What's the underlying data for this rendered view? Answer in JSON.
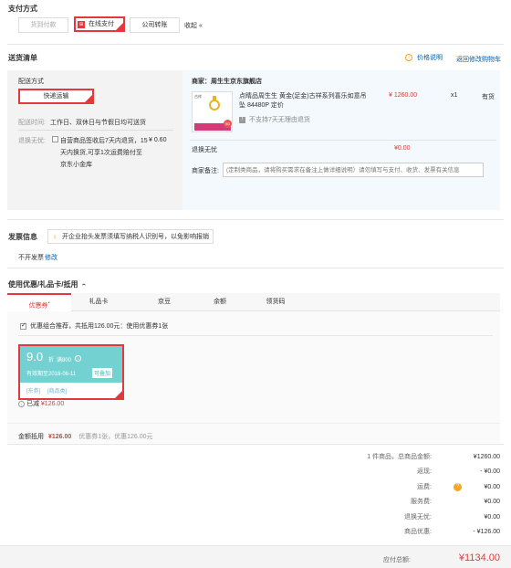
{
  "payment": {
    "title": "支付方式",
    "methods": [
      "货到付款",
      "在线支付",
      "公司转账"
    ],
    "collapse": "收起 «"
  },
  "delivery": {
    "title": "送货清单",
    "price_note": "价格说明",
    "back_cart": "返回修改购物车",
    "ship_method_label": "配送方式",
    "ship_method": "快递运输",
    "ship_time_label": "配送时间:",
    "ship_time": "工作日、双休日与节假日均可送货",
    "return_label": "退换无忧:",
    "return_text": "自营商品签收后7天内退货，15天内换货,可享1次运费赔付至京东小金库",
    "return_price": "¥ 0.60"
  },
  "shop": {
    "merchant_label": "商家：",
    "merchant": "周生生京东旗舰店",
    "item_name": "点睛品周生生 黄金(足金)古祥系列喜乐如意吊坠 84480P 定价",
    "item_price": "¥ 1260.00",
    "item_qty": "x1",
    "item_stock": "有货",
    "item_note": "不支持7天无理由退货",
    "img_caption1": "古祥",
    "img_caption2": "9G",
    "return_label": "退换无忧",
    "return_price": "¥0.00",
    "remark_label": "商家备注:",
    "remark_placeholder": "(定制类商品，请将购买需求在备注上做详细说明）请勿填写与支付、收货、发票有关信息"
  },
  "invoice": {
    "title": "发票信息",
    "tip": "开企业抬头发票须填写纳税人识别号，以免影响报销",
    "value": "不开发票",
    "modify": "修改"
  },
  "coupon": {
    "title": "使用优惠/礼品卡/抵用",
    "tabs": [
      "优惠券",
      "礼品卡",
      "京豆",
      "余额",
      "领货码"
    ],
    "tab_dot": "•",
    "combo_label": "优惠组合推荐，共抵用126.00元：使用优惠券1张",
    "card": {
      "amount": "9.0",
      "unit": "折",
      "cond": "满800",
      "expire": "有效期至2018-06-11",
      "stack": "可叠加",
      "tags": [
        "[东券]",
        "[商品类]"
      ]
    },
    "used_label": "已减",
    "used_amount": "¥126.00",
    "footer_label": "金额抵用",
    "footer_amount": "¥126.00",
    "footer_detail": "优惠券1张，优惠126.00元"
  },
  "summary": {
    "rows": [
      {
        "label": "1 件商品，总商品金额:",
        "value": "¥1260.00"
      },
      {
        "label": "返现:",
        "value": "- ¥0.00"
      },
      {
        "label": "运费:",
        "value": "¥0.00"
      },
      {
        "label": "服务费:",
        "value": "¥0.00"
      },
      {
        "label": "退换无忧:",
        "value": "¥0.00"
      },
      {
        "label": "商品优惠:",
        "value": "- ¥126.00"
      }
    ],
    "pay_label": "应付总额:",
    "pay_amount": "¥1134.00"
  },
  "colors": {
    "accent": "#e4393c",
    "teal": "#73d1d2",
    "link": "#005ea7",
    "orange": "#f6a623"
  }
}
